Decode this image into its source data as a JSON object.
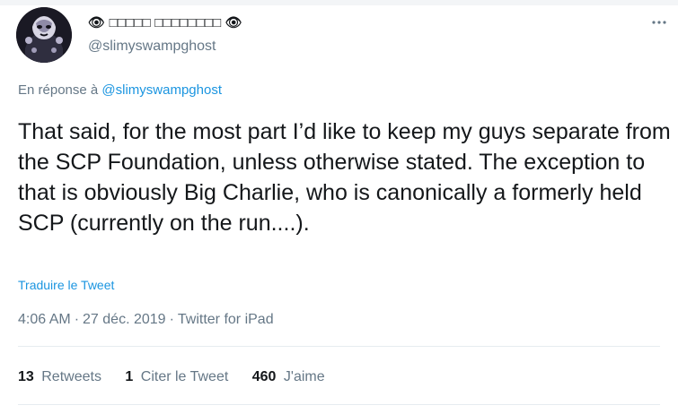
{
  "tweet": {
    "author": {
      "display_name": "👁 □□□□□ □□□□□□□□ 👁",
      "handle": "@slimyswampghost"
    },
    "reply_prefix": "En réponse à",
    "reply_handle": "@slimyswampghost",
    "text": "That said, for the most part I’d like to keep my guys separate from the SCP Foundation, unless otherwise stated. The exception to that is obviously Big Charlie, who is canonically a formerly held SCP (currently on the run....).",
    "translate_label": "Traduire le Tweet",
    "time": "4:06 AM",
    "date": "27 déc. 2019",
    "source": "Twitter for iPad",
    "stats": {
      "retweets_count": "13",
      "retweets_label": "Retweets",
      "quotes_count": "1",
      "quotes_label": "Citer le Tweet",
      "likes_count": "460",
      "likes_label": "J'aime"
    },
    "icons": {
      "avatar": "avatar-image",
      "more": "more-icon"
    }
  }
}
